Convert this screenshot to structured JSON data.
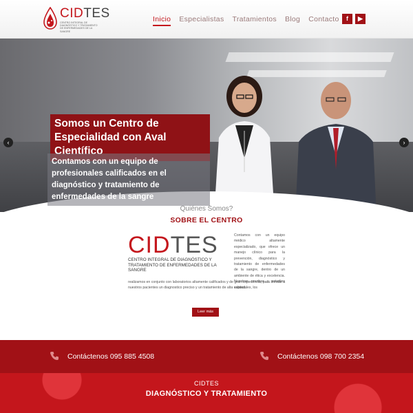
{
  "header": {
    "logo": {
      "name_red": "CID",
      "name_gray": "TES",
      "subtitle": "Centro Integral de Diagnóstico y Tratamiento de Enfermedades de la Sangre"
    },
    "nav": [
      {
        "label": "Inicio",
        "active": true
      },
      {
        "label": "Especialistas",
        "active": false
      },
      {
        "label": "Tratamientos",
        "active": false
      },
      {
        "label": "Blog",
        "active": false
      },
      {
        "label": "Contacto",
        "active": false
      }
    ],
    "social": {
      "facebook": "f",
      "youtube": "▶"
    }
  },
  "hero": {
    "title": "Somos un Centro de Especialidad con Aval Científico",
    "text": "Contamos con un equipo de profesionales calificados en el diagnóstico y tratamiento de enfermedades de la sangre",
    "prev": "‹",
    "next": "›"
  },
  "about": {
    "kicker": "Quiénes Somos?",
    "title": "SOBRE EL CENTRO",
    "logo_red": "CID",
    "logo_gray": "TES",
    "logo_subtitle": "Centro Integral de Diagnóstico y Tratamiento de Enfermedades de la Sangre",
    "text_right": "Contamos con un equipo médico altamente especializado, que ofrece un manejo clínico para la prevención, diagnóstico y tratamiento de enfermedades de la sangre, dentro de un ambiente de ética y excelencia. Nuestras pruebas y estudios especiales, los",
    "text_full": "realizamos en conjunto con laboratorios altamente calificados y de gran experiencia, para brindar a nuestros pacientes un diagnostico preciso y un tratamiento de alta calidad.",
    "button": "Leer más"
  },
  "contacts": [
    {
      "label": "Contáctenos 095 885 4508"
    },
    {
      "label": "Contáctenos 098 700 2354"
    }
  ],
  "banner": {
    "top": "CIDTES",
    "main": "DIAGNÓSTICO Y TRATAMIENTO"
  },
  "colors": {
    "brand_red": "#c4161c",
    "dark_red": "#a11116"
  }
}
